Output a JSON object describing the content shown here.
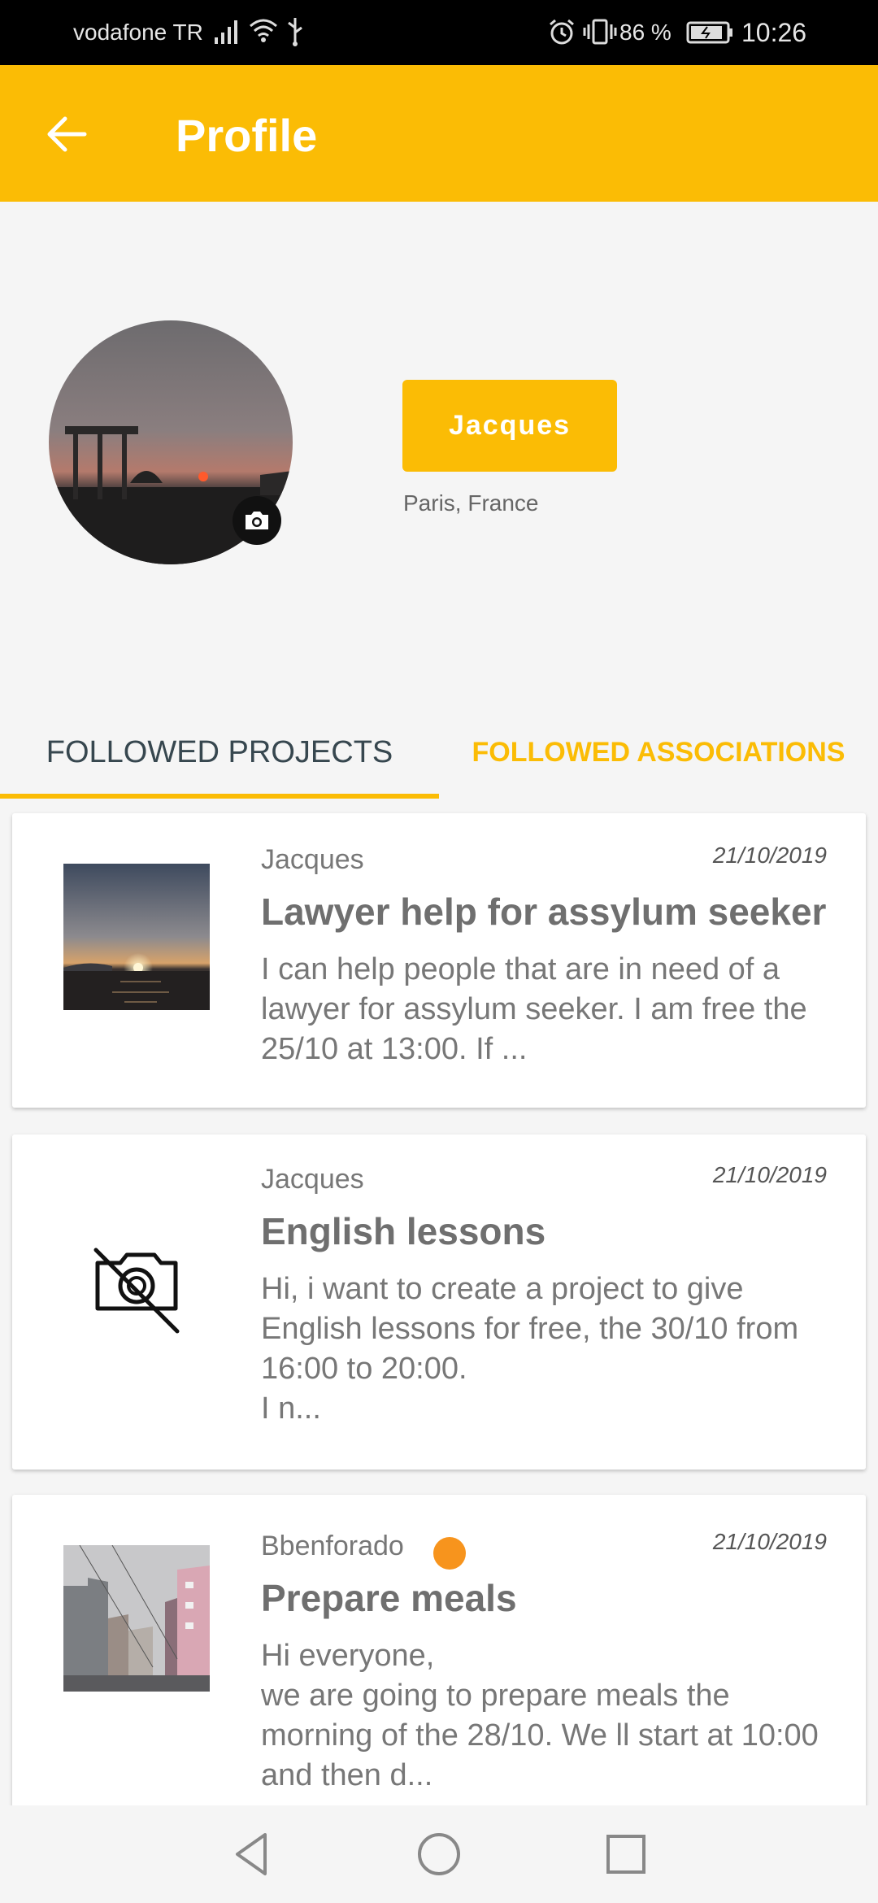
{
  "status_bar": {
    "carrier": "vodafone TR",
    "battery": "86 %",
    "time": "10:26"
  },
  "app_bar": {
    "title": "Profile"
  },
  "profile": {
    "name": "Jacques",
    "location": "Paris, France"
  },
  "tabs": [
    {
      "label": "FOLLOWED PROJECTS",
      "selected": true
    },
    {
      "label": "FOLLOWED ASSOCIATIONS",
      "selected": false
    }
  ],
  "colors": {
    "accent": "#fbbc05",
    "online_dot": "#f7941d"
  },
  "projects": [
    {
      "author": "Jacques",
      "date": "21/10/2019",
      "title": "Lawyer help for assylum seeker",
      "description": "I can help people that are in need of a lawyer for assylum seeker. I am free the 25/10 at 13:00. If ...",
      "thumbnail": "sunset-sea-photo"
    },
    {
      "author": "Jacques",
      "date": "21/10/2019",
      "title": "English lessons",
      "description": "Hi, i want to create a project to give English lessons for free, the 30/10 from 16:00 to 20:00.\nI n...",
      "thumbnail": "no-photo-icon"
    },
    {
      "author": "Bbenforado",
      "date": "21/10/2019",
      "title": "Prepare meals",
      "description": "Hi everyone,\nwe are going to prepare meals the morning of the 28/10. We ll start at 10:00 and then d...",
      "thumbnail": "street-photo"
    }
  ]
}
